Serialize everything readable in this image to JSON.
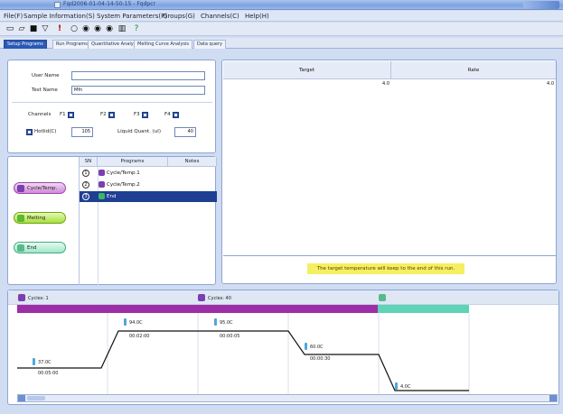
{
  "window": {
    "title": "Fqd2006-01-04-14-50-15 - Fqdpcr"
  },
  "menu": [
    "File(F)",
    "Sample Information(S)",
    "System Parameters(P)",
    "Groups(G)",
    "Channels(C)",
    "Help(H)"
  ],
  "toolbar_icons": [
    "new-file-icon",
    "open-folder-icon",
    "save-icon",
    "filter-icon",
    "run-icon",
    "circle-1-icon",
    "circle-2-icon",
    "circle-3-icon",
    "circle-4-icon",
    "stats-icon",
    "help-icon"
  ],
  "tabs": [
    "Setup Programs",
    "Run Programs",
    "Quantitative Analysis",
    "Melting Curve Analysis",
    "Data query"
  ],
  "setup": {
    "user_name_label": "User Name",
    "user_name_value": "",
    "test_name_label": "Test Name",
    "test_name_value": "Mfn",
    "channels_label": "Channels",
    "channels": [
      "F1",
      "F2",
      "F3",
      "F4"
    ],
    "hotlid_label": "Hotlid(C)",
    "hotlid_value": "105",
    "liquid_label": "Liquid Quant. (ul)",
    "liquid_value": "40"
  },
  "program_list": {
    "headers": [
      "SN",
      "Programs",
      "Notes"
    ],
    "rows": [
      {
        "sn": "1",
        "name": "Cycle/Temp.1",
        "selected": false
      },
      {
        "sn": "2",
        "name": "Cycle/Temp.2",
        "selected": false
      },
      {
        "sn": "3",
        "name": "End",
        "selected": true
      }
    ]
  },
  "side_buttons": [
    "Cycle/Temp.",
    "Melting",
    "End"
  ],
  "target_table": {
    "headers": [
      "Target",
      "Rate"
    ],
    "row": [
      "4.0",
      "4.0"
    ]
  },
  "notice": "The target temperature will keep to the end of this run.",
  "profile": {
    "stage_labels": [
      "Cycles: 1",
      "Cycles: 40"
    ],
    "steps": [
      {
        "temp": "37.0C",
        "time": "00:05:00"
      },
      {
        "temp": "94.0C",
        "time": "00:02:00"
      },
      {
        "temp": "95.0C",
        "time": "00:00:05"
      },
      {
        "temp": "60.0C",
        "time": "00:00:30"
      },
      {
        "temp": "4.0C",
        "time": ""
      }
    ]
  },
  "colors": {
    "cycle_stage": "#9c2fa5",
    "end_stage": "#5fd3b5",
    "notice_bg": "#f4f062",
    "selected_row": "#1e3f92"
  }
}
